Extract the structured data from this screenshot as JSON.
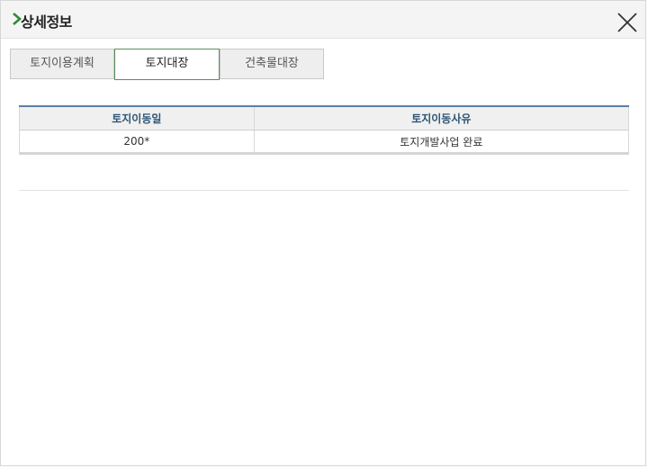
{
  "window": {
    "title": "상세정보",
    "accent_color": "#2e8b3a"
  },
  "tabs": [
    {
      "label": "토지이용계획",
      "active": false
    },
    {
      "label": "토지대장",
      "active": true
    },
    {
      "label": "건축물대장",
      "active": false
    }
  ],
  "table": {
    "headers": [
      "토지이동일",
      "토지이동사유"
    ],
    "rows": [
      [
        "200*",
        "토지개발사업 완료"
      ]
    ]
  }
}
